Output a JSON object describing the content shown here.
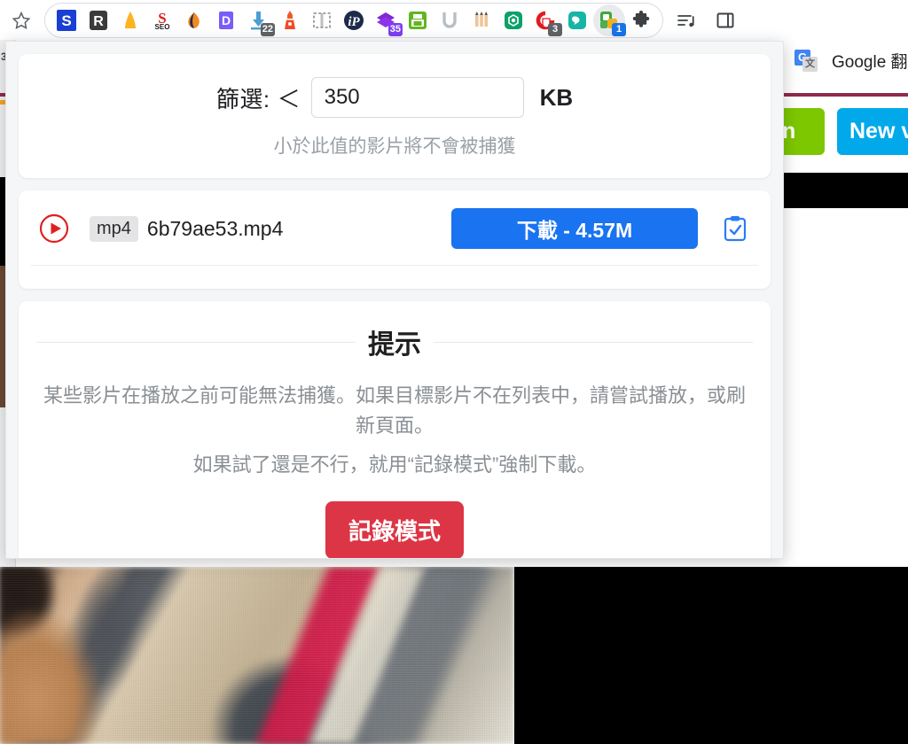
{
  "browser_toolbar": {
    "bookmark_star": "star-icon",
    "extensions": [
      {
        "name": "ext-scribe",
        "icon": "blue-square-s-icon",
        "letter": "S",
        "badge": null
      },
      {
        "name": "ext-r-tool",
        "icon": "dark-square-r-icon",
        "letter": "R",
        "badge": null
      },
      {
        "name": "ext-orange-shape",
        "icon": "orange-bell-icon",
        "letter": "",
        "badge": null
      },
      {
        "name": "ext-seo",
        "icon": "seo-red-s-icon",
        "letter": "SEO",
        "badge": null
      },
      {
        "name": "ext-honey-drop",
        "icon": "orange-drop-icon",
        "letter": "",
        "badge": null
      },
      {
        "name": "ext-d-tool",
        "icon": "purple-square-d-icon",
        "letter": "D",
        "badge": null
      },
      {
        "name": "ext-downloader",
        "icon": "download-arrow-icon",
        "letter": "",
        "badge": "22"
      },
      {
        "name": "ext-lighthouse",
        "icon": "red-lighthouse-icon",
        "letter": "",
        "badge": null
      },
      {
        "name": "ext-screenshot",
        "icon": "dashed-capture-icon",
        "letter": "",
        "badge": null
      },
      {
        "name": "ext-ip-lookup",
        "icon": "navy-circle-ip-icon",
        "letter": "iP",
        "badge": null
      },
      {
        "name": "ext-purple-stack",
        "icon": "purple-diamond-icon",
        "letter": "",
        "badge": "35"
      },
      {
        "name": "ext-print-green",
        "icon": "green-printer-icon",
        "letter": "",
        "badge": null
      },
      {
        "name": "ext-u-tool",
        "icon": "grey-u-icon",
        "letter": "U",
        "badge": null
      },
      {
        "name": "ext-pencils",
        "icon": "three-pencils-icon",
        "letter": "",
        "badge": null
      },
      {
        "name": "ext-hexagon-green",
        "icon": "green-hexagon-icon",
        "letter": "",
        "badge": null
      },
      {
        "name": "ext-stop-hand",
        "icon": "red-stop-hand-icon",
        "letter": "",
        "badge": "3"
      },
      {
        "name": "ext-chat-bubble",
        "icon": "teal-chat-bubble-icon",
        "letter": "",
        "badge": null
      },
      {
        "name": "ext-video-capture",
        "icon": "green-squares-icon",
        "letter": "",
        "badge": "1",
        "active": true
      }
    ],
    "puzzle_button": "extensions-puzzle-icon",
    "playlist_button": "playlist-music-icon",
    "sidepanel_button": "side-panel-icon"
  },
  "background_page": {
    "translate_entry_label": "Google 翻譯",
    "translate_entry_icon": "google-translate-icon",
    "green_button_label": "n",
    "blue_button_label": "New v",
    "left_edge_text": "3"
  },
  "popup": {
    "filter": {
      "label": "篩選:",
      "comparator": "＜",
      "value": "350",
      "placeholder": "",
      "unit": "KB",
      "hint": "小於此值的影片將不會被捕獲"
    },
    "videos": [
      {
        "play_icon": "red-play-circle-icon",
        "format_badge": "mp4",
        "filename": "6b79ae53.mp4",
        "download_label": "下載 - 4.57M",
        "copy_icon": "clipboard-check-icon"
      }
    ],
    "tips": {
      "title": "提示",
      "line1": "某些影片在播放之前可能無法捕獲。如果目標影片不在列表中，請嘗試播放，或刷新頁面。",
      "line2": "如果試了還是不行，就用“記錄模式”強制下載。",
      "record_button_label": "記錄模式"
    }
  },
  "colors": {
    "download_blue": "#1a73f0",
    "record_red": "#dc3545",
    "play_red": "#e02020",
    "copy_blue": "#2a7cf7",
    "popup_bg": "#f4f6f8",
    "card_bg": "#ffffff",
    "hint_grey": "#9aa0a6",
    "tips_grey": "#8a8f94",
    "bg_green_button": "#7dc700",
    "bg_blue_button": "#02a9ea"
  }
}
